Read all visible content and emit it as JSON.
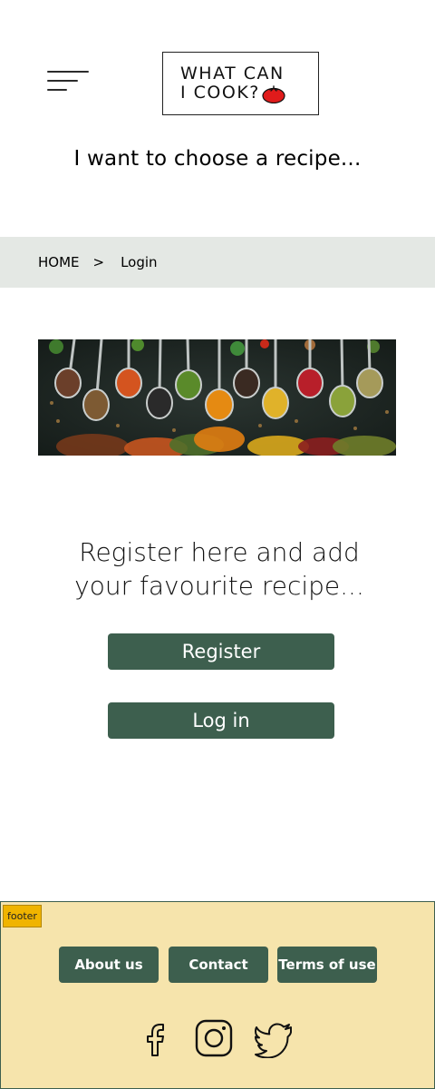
{
  "header": {
    "logo_line1": "WHAT CAN",
    "logo_line2": "I COOK?",
    "tagline": "I want to choose a recipe..."
  },
  "breadcrumb": {
    "home": "HOME",
    "separator": ">",
    "current": "Login"
  },
  "main": {
    "register_prompt_line1": "Register here and add",
    "register_prompt_line2": "your favourite recipe...",
    "register_label": "Register",
    "login_label": "Log in"
  },
  "footer": {
    "tag": "footer",
    "links": [
      "About us",
      "Contact",
      "Terms of use"
    ],
    "social_icons": [
      "facebook-icon",
      "instagram-icon",
      "twitter-icon"
    ]
  },
  "colors": {
    "primary_green": "#3d5f4e",
    "breadcrumb_bg": "#e4e8e4",
    "footer_bg": "#f6e4ac",
    "footer_tag": "#f0b400",
    "tomato_red": "#e01b1b"
  }
}
